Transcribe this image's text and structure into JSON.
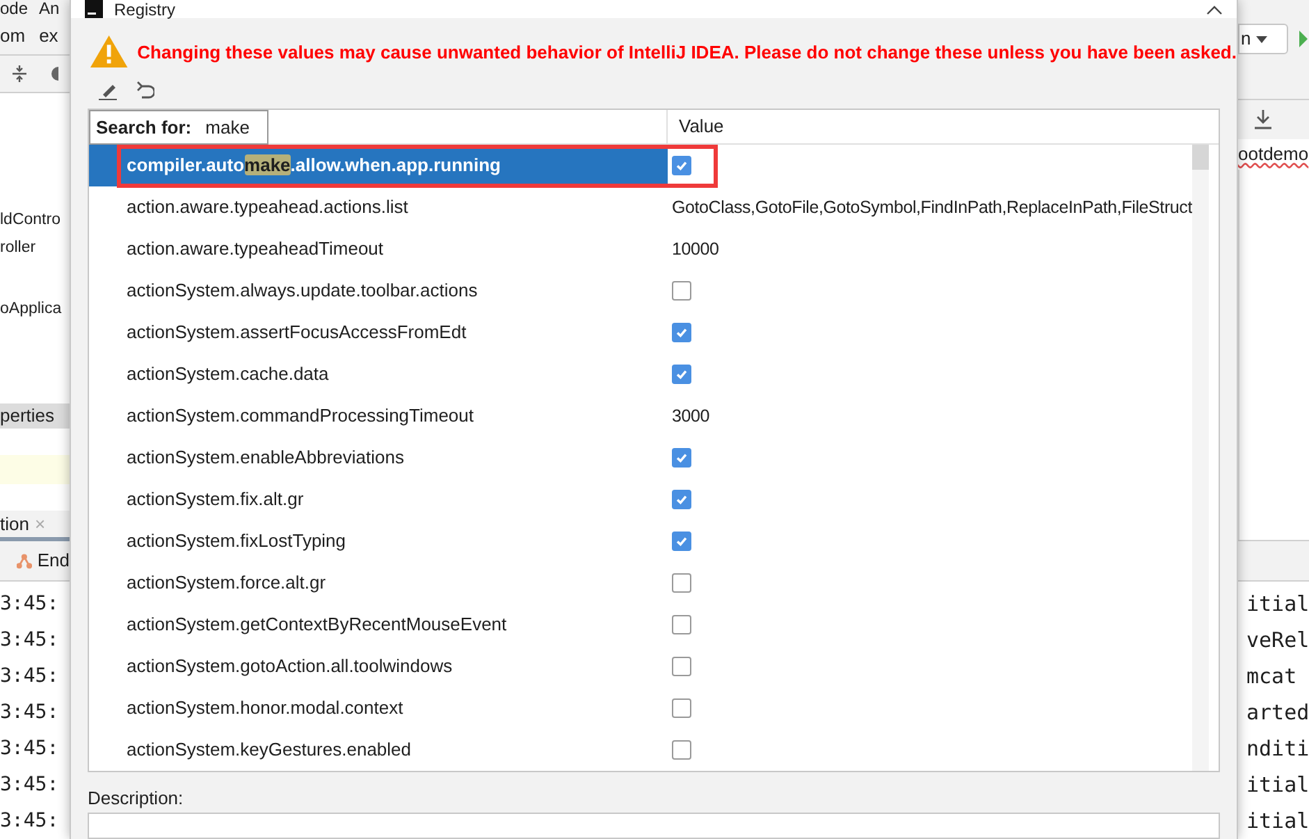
{
  "background_left": {
    "menu": [
      "ode",
      "An"
    ],
    "breadcrumb": [
      "om",
      "ex"
    ],
    "tree_items": [
      "ldContro",
      "roller",
      "oApplica"
    ],
    "properties_tab": "perties",
    "run_tab": {
      "label": "tion",
      "close": "×"
    },
    "endpoint_tab": "End",
    "log_lines": [
      "3:45:",
      "3:45:",
      "3:45:",
      "3:45:",
      "3:45:",
      "3:45:",
      "3:45:"
    ]
  },
  "background_right": {
    "dropdown": "n",
    "editor_tab": "ootdemo",
    "log_lines": [
      "itial",
      "veRel",
      "mcat",
      "arted",
      "nditi",
      "itial",
      "itial"
    ]
  },
  "dialog": {
    "title": "Registry",
    "warning": "Changing these values may cause unwanted behavior of IntelliJ IDEA. Please do not change these unless you have been asked.",
    "search": {
      "label": "Search for:",
      "value": "make"
    },
    "columns": [
      "Value"
    ],
    "rows": [
      {
        "segments": [
          {
            "text": "compiler.auto",
            "match": false
          },
          {
            "text": "make",
            "match": true
          },
          {
            "text": ".allow.when.app.running",
            "match": false
          }
        ],
        "kind": "bool",
        "checked": true,
        "selected": true,
        "outlined": true
      },
      {
        "segments": [
          {
            "text": "action.aware.typeahead.actions.list",
            "match": false
          }
        ],
        "kind": "text",
        "value": "GotoClass,GotoFile,GotoSymbol,FindInPath,ReplaceInPath,FileStruct",
        "selected": false,
        "outlined": false
      },
      {
        "segments": [
          {
            "text": "action.aware.typeaheadTimeout",
            "match": false
          }
        ],
        "kind": "text",
        "value": "10000",
        "selected": false,
        "outlined": false
      },
      {
        "segments": [
          {
            "text": "actionSystem.always.update.toolbar.actions",
            "match": false
          }
        ],
        "kind": "bool",
        "checked": false,
        "selected": false,
        "outlined": false
      },
      {
        "segments": [
          {
            "text": "actionSystem.assertFocusAccessFromEdt",
            "match": false
          }
        ],
        "kind": "bool",
        "checked": true,
        "selected": false,
        "outlined": false
      },
      {
        "segments": [
          {
            "text": "actionSystem.cache.data",
            "match": false
          }
        ],
        "kind": "bool",
        "checked": true,
        "selected": false,
        "outlined": false
      },
      {
        "segments": [
          {
            "text": "actionSystem.commandProcessingTimeout",
            "match": false
          }
        ],
        "kind": "text",
        "value": "3000",
        "selected": false,
        "outlined": false
      },
      {
        "segments": [
          {
            "text": "actionSystem.enableAbbreviations",
            "match": false
          }
        ],
        "kind": "bool",
        "checked": true,
        "selected": false,
        "outlined": false
      },
      {
        "segments": [
          {
            "text": "actionSystem.fix.alt.gr",
            "match": false
          }
        ],
        "kind": "bool",
        "checked": true,
        "selected": false,
        "outlined": false
      },
      {
        "segments": [
          {
            "text": "actionSystem.fixLostTyping",
            "match": false
          }
        ],
        "kind": "bool",
        "checked": true,
        "selected": false,
        "outlined": false
      },
      {
        "segments": [
          {
            "text": "actionSystem.force.alt.gr",
            "match": false
          }
        ],
        "kind": "bool",
        "checked": false,
        "selected": false,
        "outlined": false
      },
      {
        "segments": [
          {
            "text": "actionSystem.getContextByRecentMouseEvent",
            "match": false
          }
        ],
        "kind": "bool",
        "checked": false,
        "selected": false,
        "outlined": false
      },
      {
        "segments": [
          {
            "text": "actionSystem.gotoAction.all.toolwindows",
            "match": false
          }
        ],
        "kind": "bool",
        "checked": false,
        "selected": false,
        "outlined": false
      },
      {
        "segments": [
          {
            "text": "actionSystem.honor.modal.context",
            "match": false
          }
        ],
        "kind": "bool",
        "checked": false,
        "selected": false,
        "outlined": false
      },
      {
        "segments": [
          {
            "text": "actionSystem.keyGestures.enabled",
            "match": false
          }
        ],
        "kind": "bool",
        "checked": false,
        "selected": false,
        "outlined": false
      }
    ],
    "description_label": "Description:"
  }
}
